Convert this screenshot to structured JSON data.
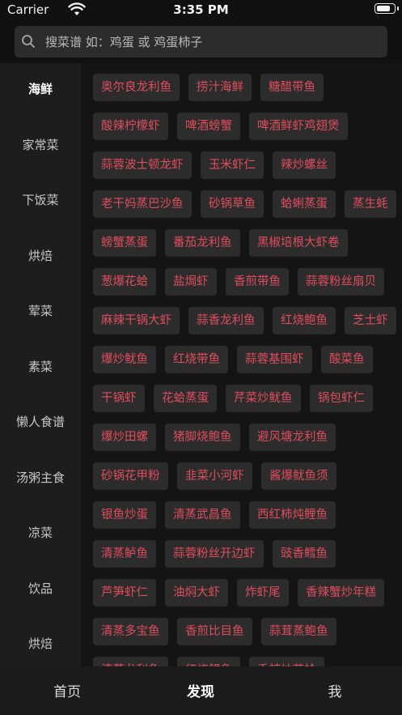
{
  "status_bar": {
    "carrier": "Carrier",
    "time": "3:35 PM",
    "battery_level": 0.85
  },
  "search": {
    "placeholder": "搜菜谱 如：鸡蛋 或 鸡蛋柿子"
  },
  "sidebar": {
    "items": [
      {
        "label": "海鲜",
        "active": true
      },
      {
        "label": "家常菜"
      },
      {
        "label": "下饭菜"
      },
      {
        "label": "烘焙"
      },
      {
        "label": "荤菜"
      },
      {
        "label": "素菜"
      },
      {
        "label": "懒人食谱"
      },
      {
        "label": "汤粥主食"
      },
      {
        "label": "凉菜"
      },
      {
        "label": "饮品"
      },
      {
        "label": "烘焙"
      }
    ]
  },
  "recipes": {
    "rows": [
      [
        "奥尔良龙利鱼",
        "捞汁海鲜",
        "糖醋带鱼"
      ],
      [
        "酸辣柠檬虾",
        "啤酒螃蟹",
        "啤酒鲜虾鸡翅煲"
      ],
      [
        "蒜蓉波士顿龙虾",
        "玉米虾仁",
        "辣炒螺丝"
      ],
      [
        "老干妈蒸巴沙鱼",
        "砂锅草鱼",
        "蛤蜊蒸蛋",
        "蒸生蚝"
      ],
      [
        "螃蟹蒸蛋",
        "番茄龙利鱼",
        "黑椒培根大虾卷"
      ],
      [
        "葱爆花蛤",
        "盐焗虾",
        "香煎带鱼",
        "蒜蓉粉丝扇贝"
      ],
      [
        "麻辣干锅大虾",
        "蒜香龙利鱼",
        "红烧鲍鱼",
        "芝士虾"
      ],
      [
        "爆炒鱿鱼",
        "红烧带鱼",
        "蒜蓉基围虾",
        "酸菜鱼"
      ],
      [
        "干锅虾",
        "花蛤蒸蛋",
        "芹菜炒鱿鱼",
        "锅包虾仁"
      ],
      [
        "爆炒田螺",
        "猪脚烧鲍鱼",
        "避风塘龙利鱼"
      ],
      [
        "砂锅花甲粉",
        "韭菜小河虾",
        "酱爆鱿鱼须"
      ],
      [
        "银鱼炒蛋",
        "清蒸武昌鱼",
        "西红柿炖鲤鱼"
      ],
      [
        "清蒸鲈鱼",
        "蒜蓉粉丝开边虾",
        "豉香鳕鱼"
      ],
      [
        "芦笋虾仁",
        "油焖大虾",
        "炸虾尾",
        "香辣蟹炒年糕"
      ],
      [
        "清蒸多宝鱼",
        "香煎比目鱼",
        "蒜茸蒸鲍鱼"
      ],
      [
        "清蒸龙利鱼",
        "红烧鲳鱼",
        "香辣炒花蛤"
      ]
    ]
  },
  "tabbar": {
    "items": [
      {
        "label": "首页"
      },
      {
        "label": "发现",
        "active": true
      },
      {
        "label": "我"
      }
    ]
  }
}
